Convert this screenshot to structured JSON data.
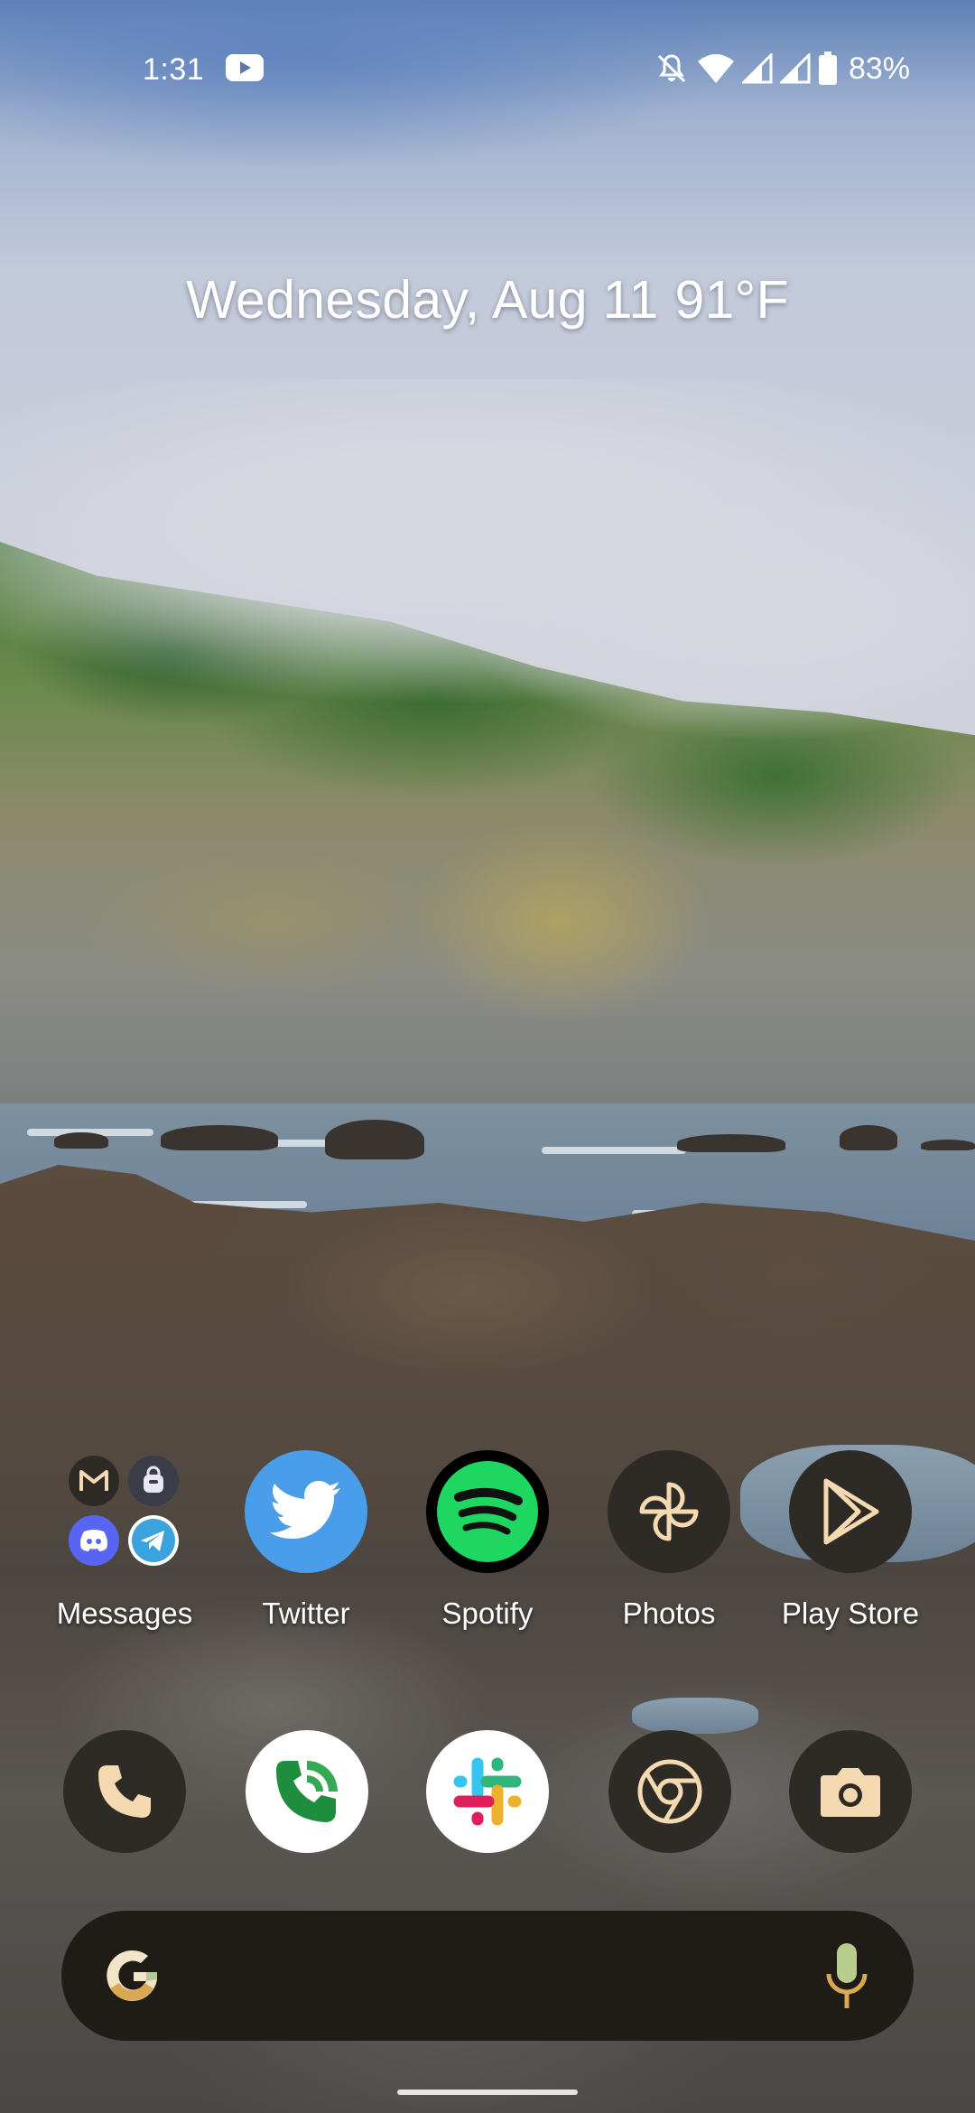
{
  "status_bar": {
    "time": "1:31",
    "notification_icons": [
      "youtube-icon"
    ],
    "system_icons": [
      "dnd-bell-off-icon",
      "wifi-icon",
      "cell-signal-icon",
      "cell-signal-icon",
      "battery-icon"
    ],
    "battery": "83%"
  },
  "widget": {
    "date": "Wednesday, Aug 11",
    "temperature": "91°F"
  },
  "apps": [
    {
      "label": "Messages",
      "icon": "folder-icon",
      "folder_contents": [
        "gmail-icon",
        "signal-like-icon",
        "discord-icon",
        "telegram-icon"
      ]
    },
    {
      "label": "Twitter",
      "icon": "twitter-icon",
      "color": "#4a9de9"
    },
    {
      "label": "Spotify",
      "icon": "spotify-icon",
      "color": "#1ed760"
    },
    {
      "label": "Photos",
      "icon": "pinwheel-icon",
      "color": "#f5d9b0"
    },
    {
      "label": "Play Store",
      "icon": "play-store-icon",
      "color": "#f5d9b0"
    }
  ],
  "dock": [
    "phone-icon",
    "google-voice-icon",
    "slack-icon",
    "chrome-icon",
    "camera-icon"
  ],
  "search": {
    "logo": "google-g-icon",
    "mic": "mic-icon"
  },
  "colors": {
    "accent": "#f5d9b0",
    "dark_icon_bg": "#2e2a26",
    "search_bg": "#1f1b16"
  }
}
